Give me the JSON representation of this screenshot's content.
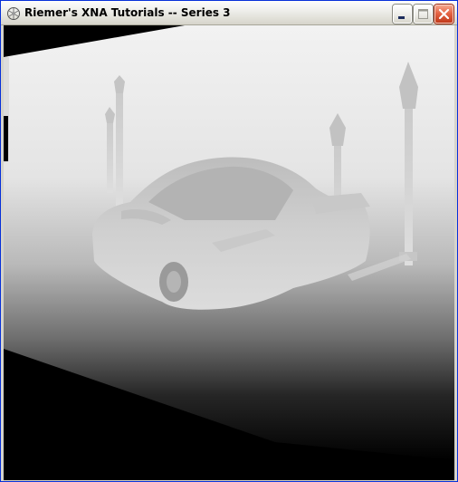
{
  "window": {
    "title": "Riemer's XNA Tutorials -- Series 3",
    "icon": "xna-app-icon",
    "buttons": {
      "minimize": "minimize-icon",
      "maximize": "maximize-icon",
      "close": "close-icon"
    }
  },
  "scene": {
    "description_kind": "depth-map-render",
    "objects": [
      "car",
      "street-lamp",
      "street-lamp",
      "street-lamp",
      "street-lamp"
    ]
  }
}
